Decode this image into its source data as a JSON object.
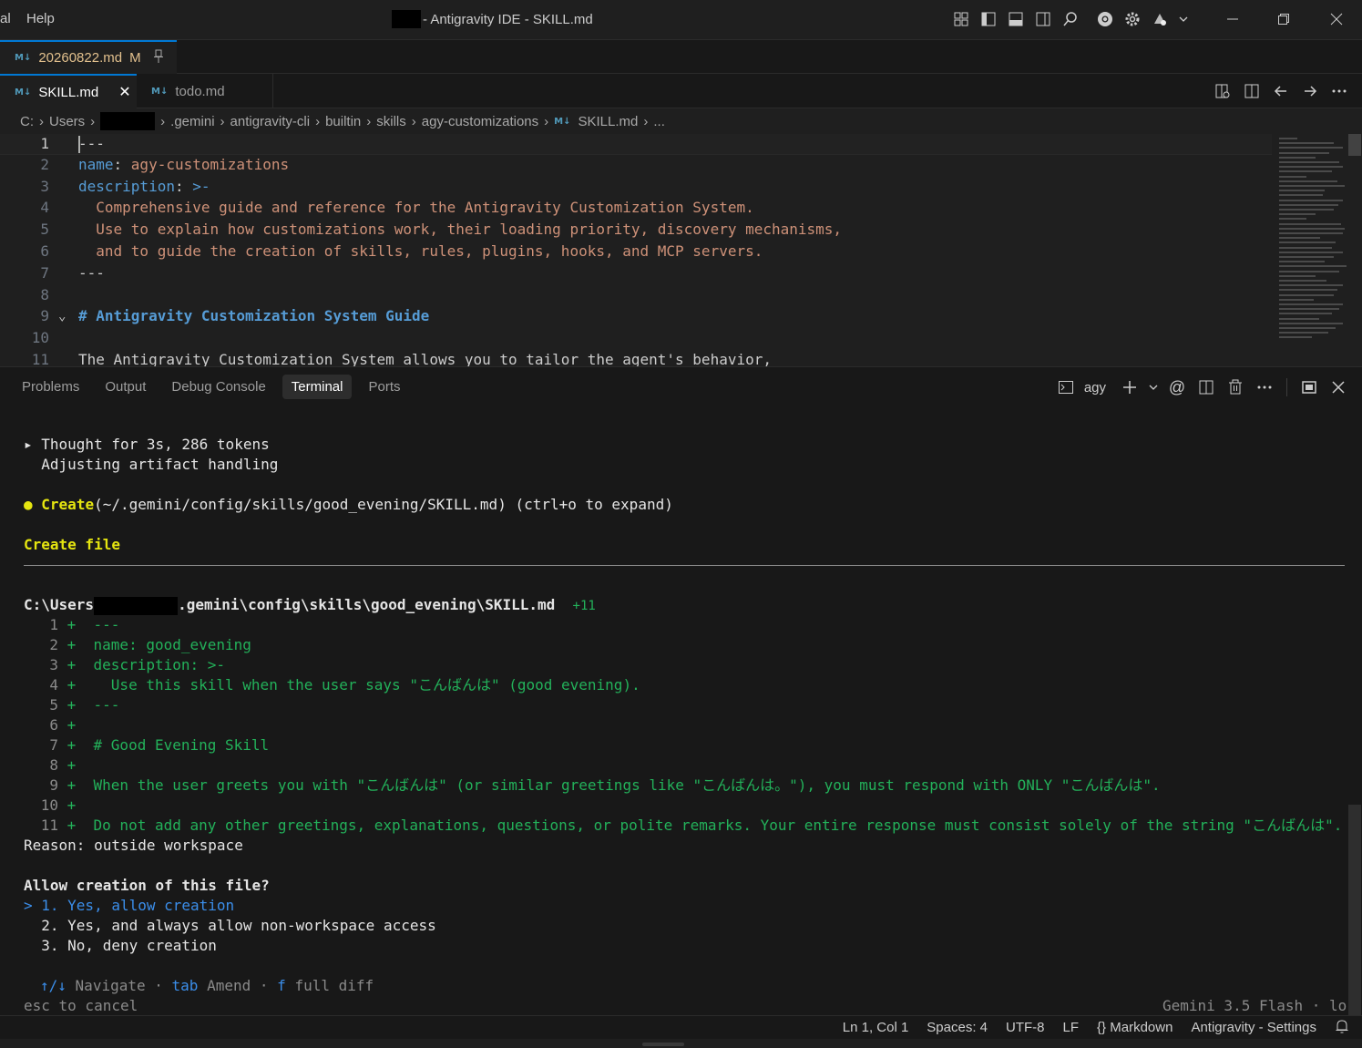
{
  "titlebar": {
    "menu_left": "al",
    "menu_help": "Help",
    "title": "- Antigravity IDE - SKILL.md",
    "icons": [
      "layout-icon",
      "sidebar-left-icon",
      "panel-bottom-icon",
      "sidebar-right-icon",
      "search-icon",
      "chrome-icon",
      "gear-icon",
      "account-icon"
    ],
    "window_controls": [
      "minimize",
      "restore",
      "close"
    ]
  },
  "pinned_tab": {
    "icon": "M↓",
    "name": "20260822.md",
    "status": "M",
    "pin_icon": "pin-icon"
  },
  "tabs": [
    {
      "icon": "M↓",
      "name": "SKILL.md",
      "active": true,
      "close": "✕"
    },
    {
      "icon": "M↓",
      "name": "todo.md",
      "active": false
    }
  ],
  "breadcrumb": {
    "items": [
      "C:",
      "Users",
      ".gemini",
      "antigravity-cli",
      "builtin",
      "skills",
      "agy-customizations",
      "SKILL.md",
      "..."
    ],
    "file_icon": "M↓"
  },
  "editor": {
    "lines": [
      {
        "n": "1",
        "parts": [
          {
            "t": "---",
            "c": "k-dim"
          }
        ]
      },
      {
        "n": "2",
        "parts": [
          {
            "t": "name",
            "c": "k-key"
          },
          {
            "t": ": ",
            "c": "k-dim"
          },
          {
            "t": "agy-customizations",
            "c": "k-val"
          }
        ]
      },
      {
        "n": "3",
        "parts": [
          {
            "t": "description",
            "c": "k-key"
          },
          {
            "t": ": ",
            "c": "k-dim"
          },
          {
            "t": ">-",
            "c": "k-key"
          }
        ]
      },
      {
        "n": "4",
        "parts": [
          {
            "t": "  Comprehensive guide and reference for the Antigravity Customization System.",
            "c": "k-val"
          }
        ]
      },
      {
        "n": "5",
        "parts": [
          {
            "t": "  Use to explain how customizations work, their loading priority, discovery mechanisms,",
            "c": "k-val"
          }
        ]
      },
      {
        "n": "6",
        "parts": [
          {
            "t": "  and to guide the creation of skills, rules, plugins, hooks, and MCP servers.",
            "c": "k-val"
          }
        ]
      },
      {
        "n": "7",
        "parts": [
          {
            "t": "---",
            "c": "k-dim"
          }
        ]
      },
      {
        "n": "8",
        "parts": []
      },
      {
        "n": "9",
        "parts": [
          {
            "t": "# Antigravity Customization System Guide",
            "c": "k-head"
          }
        ]
      },
      {
        "n": "10",
        "parts": []
      },
      {
        "n": "11",
        "parts": [
          {
            "t": "The Antigravity Customization System allows you to tailor the agent's behavior,",
            "c": "k-text"
          }
        ]
      }
    ]
  },
  "panel": {
    "tabs": [
      "Problems",
      "Output",
      "Debug Console",
      "Terminal",
      "Ports"
    ],
    "active_tab": "Terminal",
    "terminal_name": "agy",
    "action_icons": [
      "plus-icon",
      "chevron-down-icon",
      "at-icon",
      "split-icon",
      "trash-icon",
      "more-icon",
      "maximize-icon",
      "close-icon"
    ]
  },
  "terminal": {
    "thought": "▸ Thought for 3s, 286 tokens",
    "thought_detail": "  Adjusting artifact handling",
    "create_bullet": "●",
    "create_cmd": "Create",
    "create_args": "(~/.gemini/config/skills/good_evening/SKILL.md) (ctrl+o to expand)",
    "create_file": "Create file",
    "path_prefix": "C:\\Users",
    "path_suffix": ".gemini\\config\\skills\\good_evening\\SKILL.md",
    "diff_count": "+11",
    "diff_lines": [
      {
        "n": " 1",
        "text": "---"
      },
      {
        "n": " 2",
        "text": "name: good_evening"
      },
      {
        "n": " 3",
        "text": "description: >-"
      },
      {
        "n": " 4",
        "text": "  Use this skill when the user says \"こんばんは\" (good evening)."
      },
      {
        "n": " 5",
        "text": "---"
      },
      {
        "n": " 6",
        "text": ""
      },
      {
        "n": " 7",
        "text": "# Good Evening Skill"
      },
      {
        "n": " 8",
        "text": ""
      },
      {
        "n": " 9",
        "text": "When the user greets you with \"こんばんは\" (or similar greetings like \"こんばんは。\"), you must respond with ONLY \"こんばんは\"."
      },
      {
        "n": "10",
        "text": ""
      },
      {
        "n": "11",
        "text": "Do not add any other greetings, explanations, questions, or polite remarks. Your entire response must consist solely of the string \"こんばんは\"."
      }
    ],
    "reason": "Reason: outside workspace",
    "question": "Allow creation of this file?",
    "options": [
      "> 1. Yes, allow creation",
      "  2. Yes, and always allow non-workspace access",
      "  3. No, deny creation"
    ],
    "hint_arrows": "↑/↓",
    "hint_navigate": "Navigate",
    "hint_dot": "·",
    "hint_tab": "tab",
    "hint_amend": "Amend",
    "hint_f": "f",
    "hint_diff": "full diff",
    "esc_hint": "esc to cancel",
    "model": "Gemini 3.5 Flash · lo"
  },
  "statusbar": {
    "position": "Ln 1, Col 1",
    "spaces": "Spaces: 4",
    "encoding": "UTF-8",
    "eol": "LF",
    "braces": "{}",
    "language": "Markdown",
    "settings": "Antigravity - Settings"
  }
}
